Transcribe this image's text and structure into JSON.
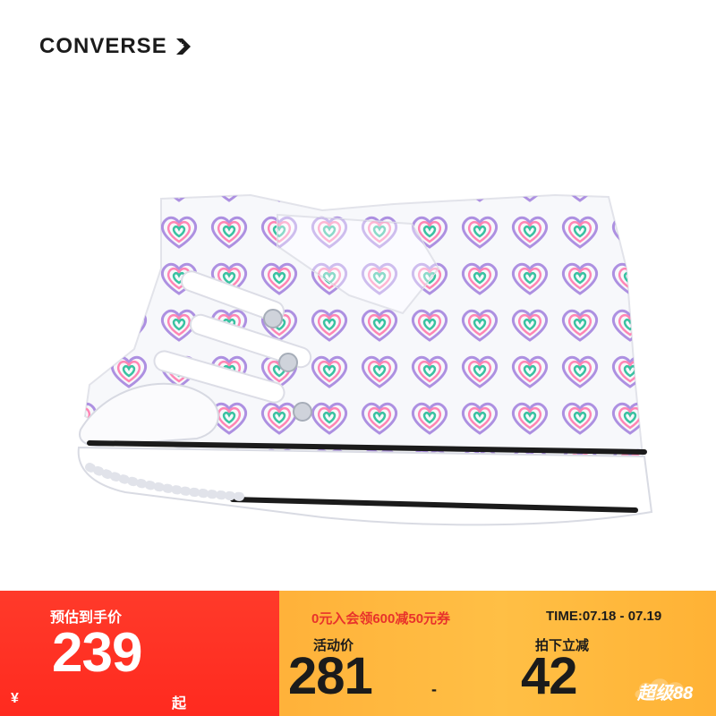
{
  "brand": {
    "name": "CONVERSE"
  },
  "product": {
    "image": "converse-kids-heart-print-high-top-sneaker"
  },
  "banner": {
    "estimate_label": "预估到手价",
    "estimate_price": "239",
    "currency": "¥",
    "price_suffix": "起",
    "coupon_text": "0元入会领600减50元券",
    "time_text": "TIME:07.18 - 07.19",
    "activity_label": "活动价",
    "activity_price": "281",
    "separator": "-",
    "discount_label": "拍下立减",
    "discount_value": "42",
    "badge_text": "超级88"
  },
  "colors": {
    "red": "#ff2a1f",
    "orange": "#ffb23a",
    "dark": "#1b1b1b"
  }
}
